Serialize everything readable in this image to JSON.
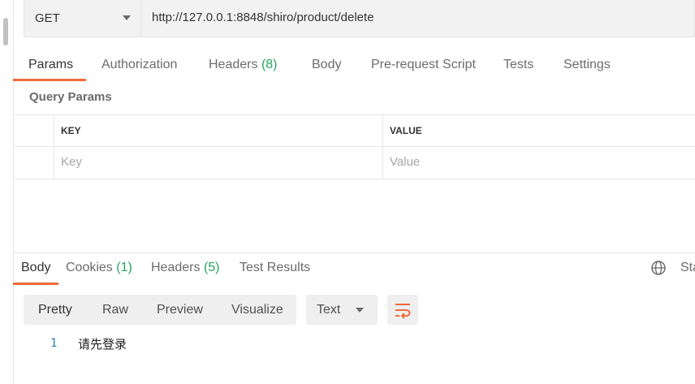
{
  "request": {
    "method": "GET",
    "url": "http://127.0.0.1:8848/shiro/product/delete"
  },
  "request_tabs": [
    {
      "label": "Params",
      "count": ""
    },
    {
      "label": "Authorization",
      "count": ""
    },
    {
      "label": "Headers",
      "count": "(8)"
    },
    {
      "label": "Body",
      "count": ""
    },
    {
      "label": "Pre-request Script",
      "count": ""
    },
    {
      "label": "Tests",
      "count": ""
    },
    {
      "label": "Settings",
      "count": ""
    }
  ],
  "params": {
    "section_title": "Query Params",
    "key_header": "KEY",
    "value_header": "VALUE",
    "key_placeholder": "Key",
    "value_placeholder": "Value"
  },
  "response_tabs": [
    {
      "label": "Body",
      "count": ""
    },
    {
      "label": "Cookies",
      "count": "(1)"
    },
    {
      "label": "Headers",
      "count": "(5)"
    },
    {
      "label": "Test Results",
      "count": ""
    }
  ],
  "response_status_cut": "Sta",
  "format_buttons": [
    "Pretty",
    "Raw",
    "Preview",
    "Visualize"
  ],
  "format_type": "Text",
  "body_lines": [
    {
      "number": "1",
      "text": "请先登录"
    }
  ],
  "colors": {
    "accent": "#f26b3a",
    "count_green": "#26a55c"
  }
}
